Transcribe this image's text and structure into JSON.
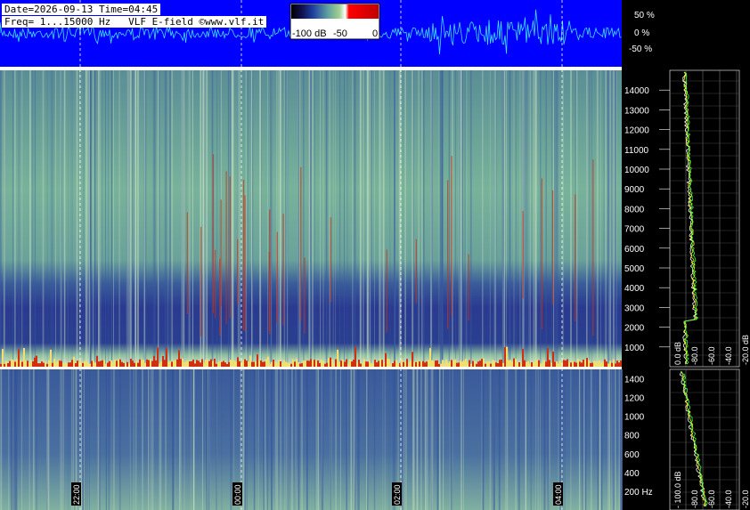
{
  "header": {
    "date_line": "Date=2026-09-13 Time=04:45",
    "freq_line": "Freq= 1...15000 Hz   VLF E-field ©www.vlf.it"
  },
  "colors": {
    "waveform_bg": "#0000ff",
    "waveform_trace": "#40e0ff",
    "spectrogram_low": "#1a2a7a",
    "spectrogram_mid": "#5f9a8e",
    "spectrogram_high": "#f0f0c0",
    "spectrogram_peak": "#d03010",
    "colorbar": [
      "#000000",
      "#101050",
      "#2040a0",
      "#60a0a0",
      "#a0d090",
      "#ffffff",
      "#ff0000",
      "#c00000"
    ],
    "profile_white": "#ffffff",
    "profile_yellow": "#ffff00",
    "profile_green": "#40ff40",
    "profile_red": "#ff3030"
  },
  "chart_data": [
    {
      "type": "colorbar",
      "ticks": [
        "-100 dB",
        "-50",
        "0"
      ]
    },
    {
      "type": "line",
      "ticks": [
        "50 %",
        "0 %",
        "-50 %"
      ]
    },
    {
      "type": "heatmap",
      "ylabel": "",
      "xlabel": "",
      "ylim": [
        0,
        15000
      ],
      "y_ticks": [
        14000,
        13000,
        12000,
        11000,
        10000,
        9000,
        8000,
        7000,
        6000,
        5000,
        4000,
        3000,
        2000,
        1000
      ],
      "profile_ticks": [
        "0.0 dB",
        "-80.0",
        "-60.0",
        "-40.0",
        "-20.0 dB"
      ]
    },
    {
      "type": "heatmap",
      "ylim": [
        0,
        1500
      ],
      "y_ticks": [
        1400,
        1200,
        1000,
        800,
        600,
        400
      ],
      "y_ticks_unit": "200 Hz",
      "x_ticks": [
        "22:00",
        "00:00",
        "02:00",
        "04:00"
      ],
      "profile_ticks": [
        "- 100.0 dB",
        "-80.0",
        "-60.0",
        "-40.0",
        "-20.0"
      ]
    }
  ]
}
